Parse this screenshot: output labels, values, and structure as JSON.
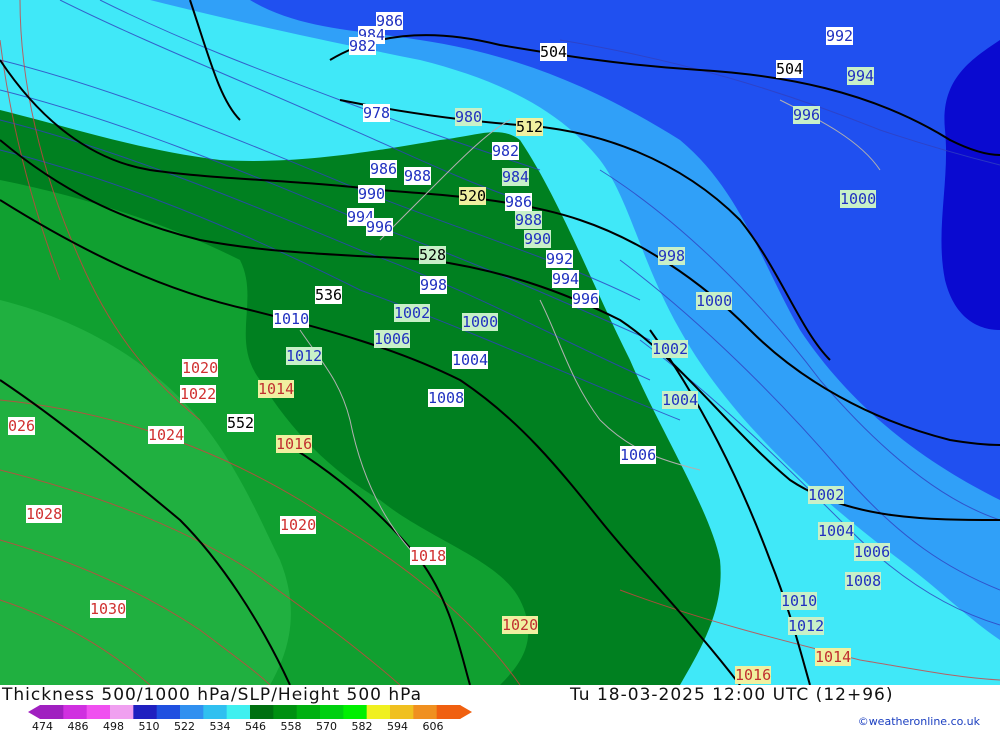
{
  "title": "Thickness 500/1000 hPa/SLP/Height 500 hPa",
  "datetime": "Tu 18-03-2025 12:00 UTC (12+96)",
  "credit": "©weatheronline.co.uk",
  "legend": {
    "ticks": [
      "474",
      "486",
      "498",
      "510",
      "522",
      "534",
      "546",
      "558",
      "570",
      "582",
      "594",
      "606"
    ],
    "colors": [
      "#a020c0",
      "#d030e0",
      "#f050f0",
      "#f0a0f0",
      "#2020c0",
      "#2050e0",
      "#3090f0",
      "#30c0f0",
      "#40f0f0",
      "#007010",
      "#009010",
      "#00b010",
      "#00d010",
      "#00f000",
      "#f0f020",
      "#f0c020",
      "#f09020",
      "#f06010"
    ]
  },
  "palette": {
    "dark_blue": "#0a0ad0",
    "blue": "#2050f0",
    "light_blue": "#30a0f8",
    "cyan": "#40e8f8",
    "dark_green": "#008020",
    "green": "#00a020",
    "mid_green": "#10b030"
  },
  "labels": {
    "slp_blue": [
      {
        "text": "986"
      },
      {
        "text": "984"
      },
      {
        "text": "982"
      },
      {
        "text": "992"
      },
      {
        "text": "978"
      },
      {
        "text": "986"
      },
      {
        "text": "988"
      },
      {
        "text": "990"
      },
      {
        "text": "994"
      },
      {
        "text": "996"
      },
      {
        "text": "998"
      },
      {
        "text": "1010"
      },
      {
        "text": "1012"
      },
      {
        "text": "1006"
      },
      {
        "text": "1004"
      },
      {
        "text": "1008"
      },
      {
        "text": "1006"
      },
      {
        "text": "992"
      },
      {
        "text": "994"
      },
      {
        "text": "996"
      },
      {
        "text": "982"
      },
      {
        "text": "986"
      }
    ],
    "slp_green": [
      {
        "text": "994"
      },
      {
        "text": "996"
      },
      {
        "text": "980"
      },
      {
        "text": "984"
      },
      {
        "text": "988"
      },
      {
        "text": "990"
      },
      {
        "text": "1000"
      },
      {
        "text": "998"
      },
      {
        "text": "1000"
      },
      {
        "text": "1002"
      },
      {
        "text": "1004"
      },
      {
        "text": "1002"
      },
      {
        "text": "1004"
      },
      {
        "text": "1006"
      },
      {
        "text": "1008"
      },
      {
        "text": "1010"
      },
      {
        "text": "1012"
      },
      {
        "text": "1014"
      },
      {
        "text": "1016"
      },
      {
        "text": "1002"
      },
      {
        "text": "1006"
      },
      {
        "text": "1000"
      }
    ],
    "slp_red": [
      {
        "text": "1020"
      },
      {
        "text": "1022"
      },
      {
        "text": "1024"
      },
      {
        "text": "026"
      },
      {
        "text": "1028"
      },
      {
        "text": "1030"
      },
      {
        "text": "1014"
      },
      {
        "text": "1016"
      },
      {
        "text": "1020"
      },
      {
        "text": "1018"
      },
      {
        "text": "1020"
      },
      {
        "text": "1016"
      }
    ],
    "height": [
      {
        "text": "504"
      },
      {
        "text": "504"
      },
      {
        "text": "512"
      },
      {
        "text": "520"
      },
      {
        "text": "528"
      },
      {
        "text": "536"
      },
      {
        "text": "552"
      }
    ]
  }
}
